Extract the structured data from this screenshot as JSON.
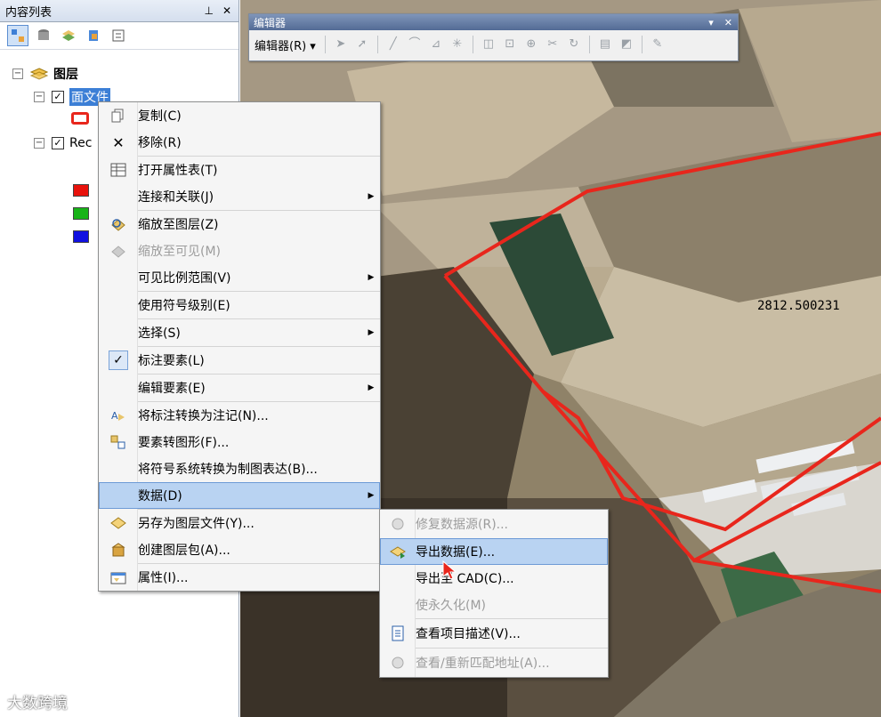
{
  "toc": {
    "title": "内容列表",
    "title_buttons": [
      "ㅁ",
      "✕"
    ],
    "root_label": "图层",
    "layer1_label": "面文件",
    "layer2_label": "Rec"
  },
  "editor": {
    "title": "编辑器",
    "menu_label": "编辑器(R) ▾",
    "controls": [
      "▾",
      "✕"
    ]
  },
  "map": {
    "measure_label": "2812.500231",
    "boundary_color": "#e8261c"
  },
  "context_menu": {
    "items": [
      {
        "label": "复制(C)",
        "icon": "copy-icon"
      },
      {
        "label": "移除(R)",
        "icon": "remove-icon"
      },
      {
        "label": "打开属性表(T)",
        "icon": "table-icon"
      },
      {
        "label": "连接和关联(J)",
        "icon": "",
        "submenu": true
      },
      {
        "label": "缩放至图层(Z)",
        "icon": "zoom-layer-icon"
      },
      {
        "label": "缩放至可见(M)",
        "icon": "zoom-visible-icon",
        "disabled": true
      },
      {
        "label": "可见比例范围(V)",
        "icon": "",
        "submenu": true
      },
      {
        "label": "使用符号级别(E)",
        "icon": ""
      },
      {
        "label": "选择(S)",
        "icon": "",
        "submenu": true
      },
      {
        "label": "标注要素(L)",
        "icon": "checkmark-icon"
      },
      {
        "label": "编辑要素(E)",
        "icon": "",
        "submenu": true
      },
      {
        "label": "将标注转换为注记(N)...",
        "icon": "convert-labels-icon"
      },
      {
        "label": "要素转图形(F)...",
        "icon": "features-graphics-icon"
      },
      {
        "label": "将符号系统转换为制图表达(B)...",
        "icon": ""
      },
      {
        "label": "数据(D)",
        "icon": "",
        "submenu": true,
        "highlighted": true
      },
      {
        "label": "另存为图层文件(Y)...",
        "icon": "layer-file-icon"
      },
      {
        "label": "创建图层包(A)...",
        "icon": "layer-package-icon"
      },
      {
        "label": "属性(I)...",
        "icon": "properties-icon"
      }
    ]
  },
  "data_submenu": {
    "items": [
      {
        "label": "修复数据源(R)...",
        "disabled": true
      },
      {
        "label": "导出数据(E)...",
        "highlighted": true
      },
      {
        "label": "导出至 CAD(C)..."
      },
      {
        "label": "使永久化(M)",
        "disabled": true
      },
      {
        "label": "查看项目描述(V)..."
      },
      {
        "label": "查看/重新匹配地址(A)...",
        "disabled": true
      }
    ]
  },
  "watermark": "大数跨境"
}
